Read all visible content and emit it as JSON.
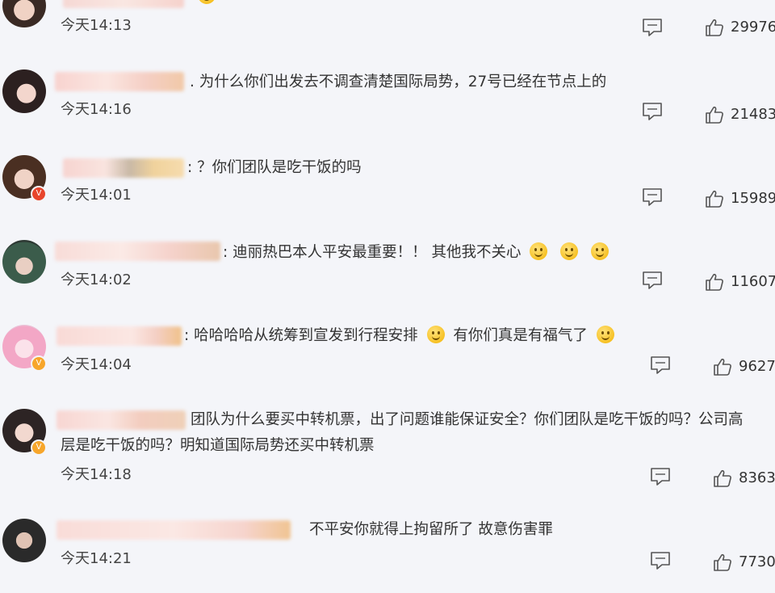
{
  "comments": [
    {
      "text_parts": [],
      "time": "今天14:13",
      "likes": "29976"
    },
    {
      "text_parts": [
        ". 为什么你们出发去不调查清楚国际局势，27号已经在节点上的"
      ],
      "time": "今天14:16",
      "likes": "21483"
    },
    {
      "text_parts": [
        ": ？你们团队是吃干饭的吗"
      ],
      "time": "今天14:01",
      "likes": "15989"
    },
    {
      "text_parts": [
        ": 迪丽热巴本人平安最重要！！ 其他我不关心"
      ],
      "time": "今天14:02",
      "likes": "11607"
    },
    {
      "text_parts": [
        ": 哈哈哈哈从统筹到宣发到行程安排",
        " 有你们真是有福气了"
      ],
      "time": "今天14:04",
      "likes": "9627"
    },
    {
      "text_parts": [
        "团队为什么要买中转机票，出了问题谁能保证安全？你们团队是吃干饭的吗？公司高",
        "层是吃干饭的吗？明知道国际局势还买中转机票"
      ],
      "time": "今天14:18",
      "likes": "8363"
    },
    {
      "text_parts": [
        "不平安你就得上拘留所了 故意伤害罪"
      ],
      "time": "今天14:21",
      "likes": "7730"
    }
  ],
  "colors": {
    "background": "#f4f5f9",
    "verified_orange": "#f7a62b",
    "verified_red": "#e8452c",
    "icon_gray": "#555555"
  },
  "icons": {
    "reply": "comment-icon",
    "like": "thumbs-up-icon",
    "emoji": "smile-emoji-icon"
  }
}
